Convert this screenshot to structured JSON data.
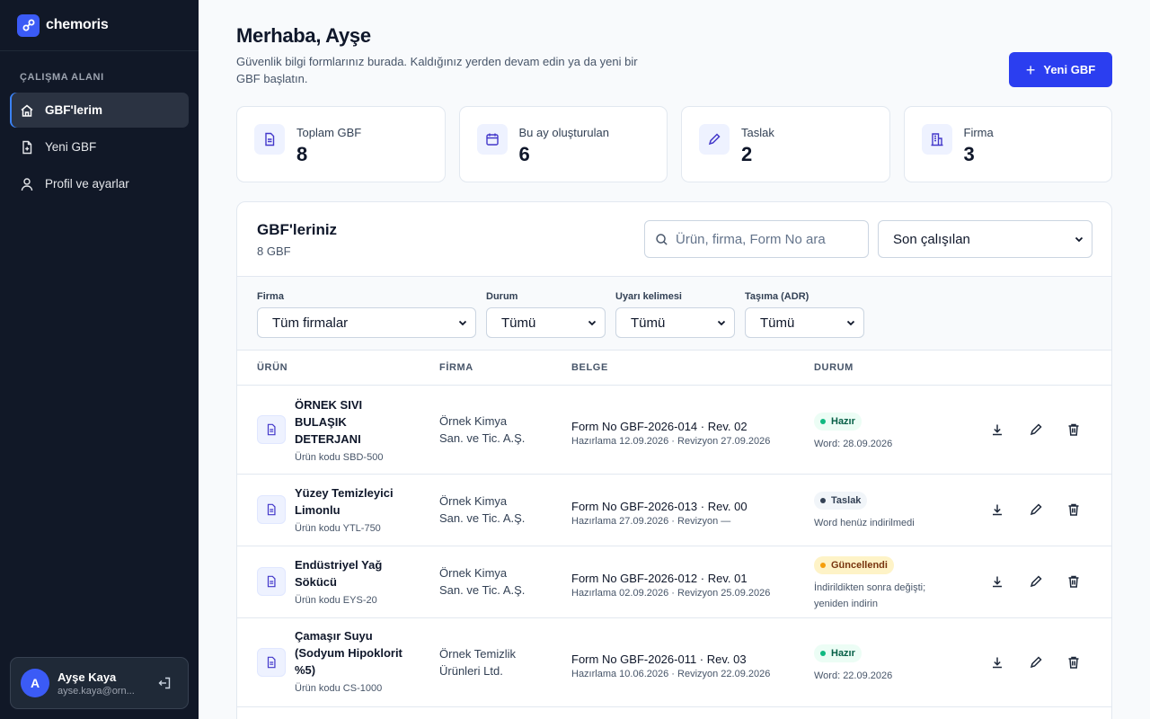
{
  "brand": {
    "name": "chemoris"
  },
  "sidebar": {
    "section_label": "ÇALIŞMA ALANI",
    "items": [
      {
        "label": "GBF'lerim",
        "icon": "home-icon",
        "active": true
      },
      {
        "label": "Yeni GBF",
        "icon": "file-plus-icon",
        "active": false
      },
      {
        "label": "Profil ve ayarlar",
        "icon": "user-icon",
        "active": false
      }
    ],
    "user": {
      "initial": "A",
      "name": "Ayşe Kaya",
      "email": "ayse.kaya@ornek.com",
      "email_display": "ayse.kaya@orn..."
    }
  },
  "header": {
    "title": "Merhaba, Ayşe",
    "subtitle": "Güvenlik bilgi formlarınız burada. Kaldığınız yerden devam edin ya da yeni bir GBF başlatın.",
    "new_button": "Yeni GBF"
  },
  "stats": [
    {
      "label": "Toplam GBF",
      "value": "8",
      "icon": "document-icon"
    },
    {
      "label": "Bu ay oluşturulan",
      "value": "6",
      "icon": "calendar-icon"
    },
    {
      "label": "Taslak",
      "value": "2",
      "icon": "pencil-icon"
    },
    {
      "label": "Firma",
      "value": "3",
      "icon": "building-icon"
    }
  ],
  "panel": {
    "title": "GBF'leriniz",
    "count": "8 GBF",
    "search_placeholder": "Ürün, firma, Form No ara",
    "sort_value": "Son çalışılan",
    "filters": [
      {
        "label": "Firma",
        "value": "Tüm firmalar"
      },
      {
        "label": "Durum",
        "value": "Tümü"
      },
      {
        "label": "Uyarı kelimesi",
        "value": "Tümü"
      },
      {
        "label": "Taşıma (ADR)",
        "value": "Tümü"
      }
    ],
    "columns": [
      "ÜRÜN",
      "FİRMA",
      "BELGE",
      "DURUM"
    ]
  },
  "rows": [
    {
      "product_lines": [
        "ÖRNEK SIVI",
        "BULAŞIK",
        "DETERJANI"
      ],
      "code": "Ürün kodu SBD-500",
      "firm_lines": [
        "Örnek Kimya",
        "San. ve Tic. A.Ş."
      ],
      "form": "Form No GBF-2026-014 · Rev. 02",
      "dates": "Hazırlama 12.09.2026 · Revizyon 27.09.2026",
      "status": "Hazır",
      "status_type": "ready",
      "note_lines": [
        "Word: 28.09.2026"
      ]
    },
    {
      "product_lines": [
        "Yüzey Temizleyici",
        "Limonlu"
      ],
      "code": "Ürün kodu YTL-750",
      "firm_lines": [
        "Örnek Kimya",
        "San. ve Tic. A.Ş."
      ],
      "form": "Form No GBF-2026-013 · Rev. 00",
      "dates": "Hazırlama 27.09.2026 · Revizyon —",
      "status": "Taslak",
      "status_type": "draft",
      "note_lines": [
        "Word henüz indirilmedi"
      ]
    },
    {
      "product_lines": [
        "Endüstriyel Yağ",
        "Sökücü"
      ],
      "code": "Ürün kodu EYS-20",
      "firm_lines": [
        "Örnek Kimya",
        "San. ve Tic. A.Ş."
      ],
      "form": "Form No GBF-2026-012 · Rev. 01",
      "dates": "Hazırlama 02.09.2026 · Revizyon 25.09.2026",
      "status": "Güncellendi",
      "status_type": "updated",
      "note_lines": [
        "İndirildikten sonra değişti;",
        "yeniden indirin"
      ]
    },
    {
      "product_lines": [
        "Çamaşır Suyu",
        "(Sodyum Hipoklorit",
        "%5)"
      ],
      "code": "Ürün kodu CS-1000",
      "firm_lines": [
        "Örnek Temizlik",
        "Ürünleri Ltd."
      ],
      "form": "Form No GBF-2026-011 · Rev. 03",
      "dates": "Hazırlama 10.06.2026 · Revizyon 22.09.2026",
      "status": "Hazır",
      "status_type": "ready",
      "note_lines": [
        "Word: 22.09.2026"
      ]
    }
  ],
  "colors": {
    "sidebar_bg": "#111827",
    "accent": "#2b3ef0",
    "ready": "#10b981",
    "updated": "#f59e0b"
  }
}
